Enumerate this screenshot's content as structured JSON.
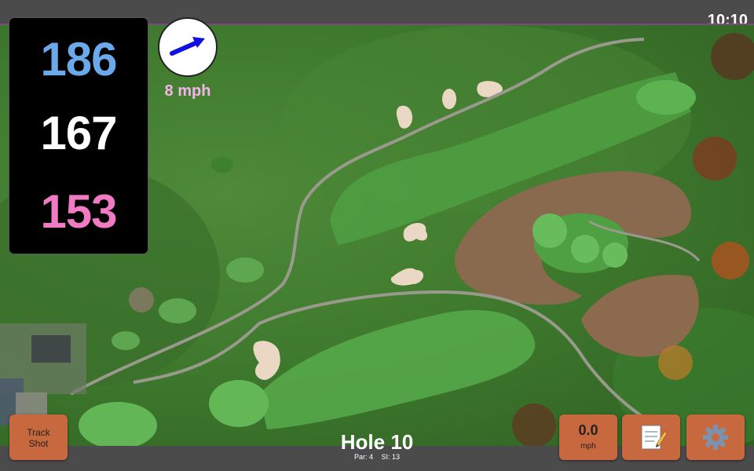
{
  "status_bar": {
    "time": "10:10"
  },
  "distances": {
    "back": "186",
    "middle": "167",
    "front": "153"
  },
  "wind": {
    "speed": "8 mph",
    "arrow_icon": "arrow-right-icon",
    "arrow_color": "#1010e0"
  },
  "hole": {
    "title": "Hole 10",
    "par": "Par: 4",
    "stroke_index": "SI: 13"
  },
  "buttons": {
    "track_shot_line1": "Track",
    "track_shot_line2": "Shot",
    "speed_value": "0.0",
    "speed_unit": "mph",
    "notes_icon": "notepad-icon",
    "settings_icon": "gear-icon"
  },
  "colors": {
    "back_distance": "#6aa9ea",
    "middle_distance": "#ffffff",
    "front_distance": "#f07bc4",
    "button_bg": "#c8683e",
    "wind_text": "#f7b3ec"
  }
}
